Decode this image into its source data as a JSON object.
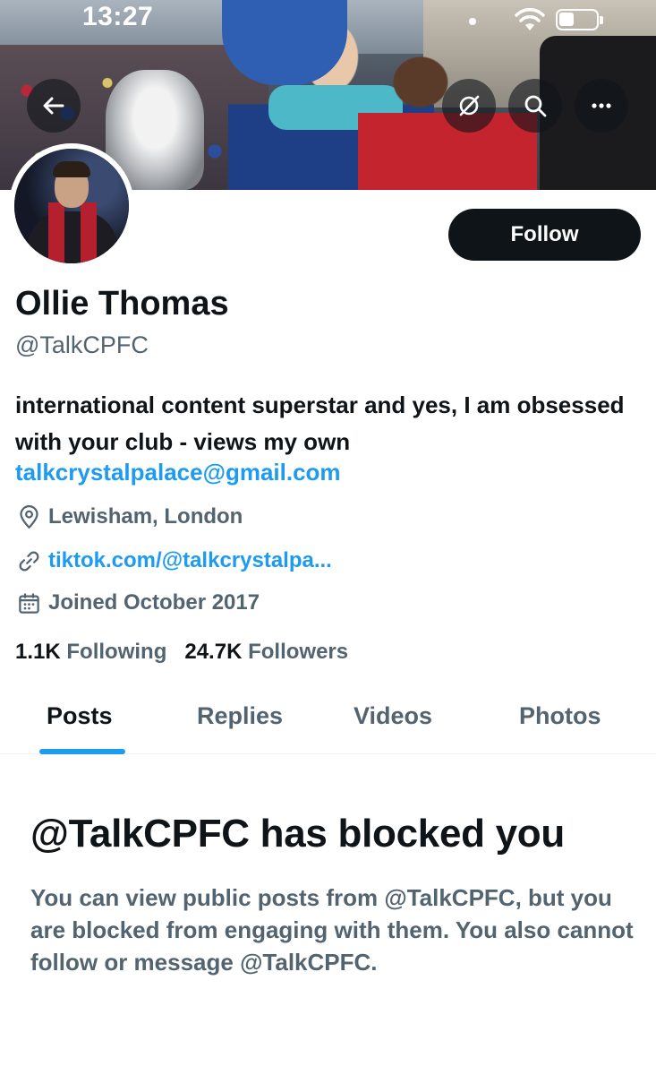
{
  "status_bar": {
    "time": "13:27"
  },
  "header": {
    "icons": [
      "back-arrow-icon",
      "grok-icon",
      "search-icon",
      "more-icon"
    ]
  },
  "profile": {
    "display_name": "Ollie Thomas",
    "handle": "@TalkCPFC",
    "bio": "international content superstar and yes, I am obsessed with your club - views my own",
    "bio_link": "talkcrystalpalace@gmail.com",
    "location": "Lewisham, London",
    "website": "tiktok.com/@talkcrystalpa...",
    "joined": "Joined October 2017",
    "following_count": "1.1K",
    "following_label": "Following",
    "followers_count": "24.7K",
    "followers_label": "Followers",
    "follow_button_label": "Follow"
  },
  "tabs": [
    {
      "label": "Posts",
      "active": true
    },
    {
      "label": "Replies",
      "active": false
    },
    {
      "label": "Videos",
      "active": false
    },
    {
      "label": "Photos",
      "active": false
    }
  ],
  "blocked": {
    "title": "@TalkCPFC has blocked you",
    "body": "You can view public posts from @TalkCPFC, but you are blocked from engaging with them. You also cannot follow or message @TalkCPFC."
  },
  "colors": {
    "accent": "#1d9bf0",
    "text_primary": "#0f1419",
    "text_secondary": "#536471",
    "button_bg": "#0f1419"
  }
}
